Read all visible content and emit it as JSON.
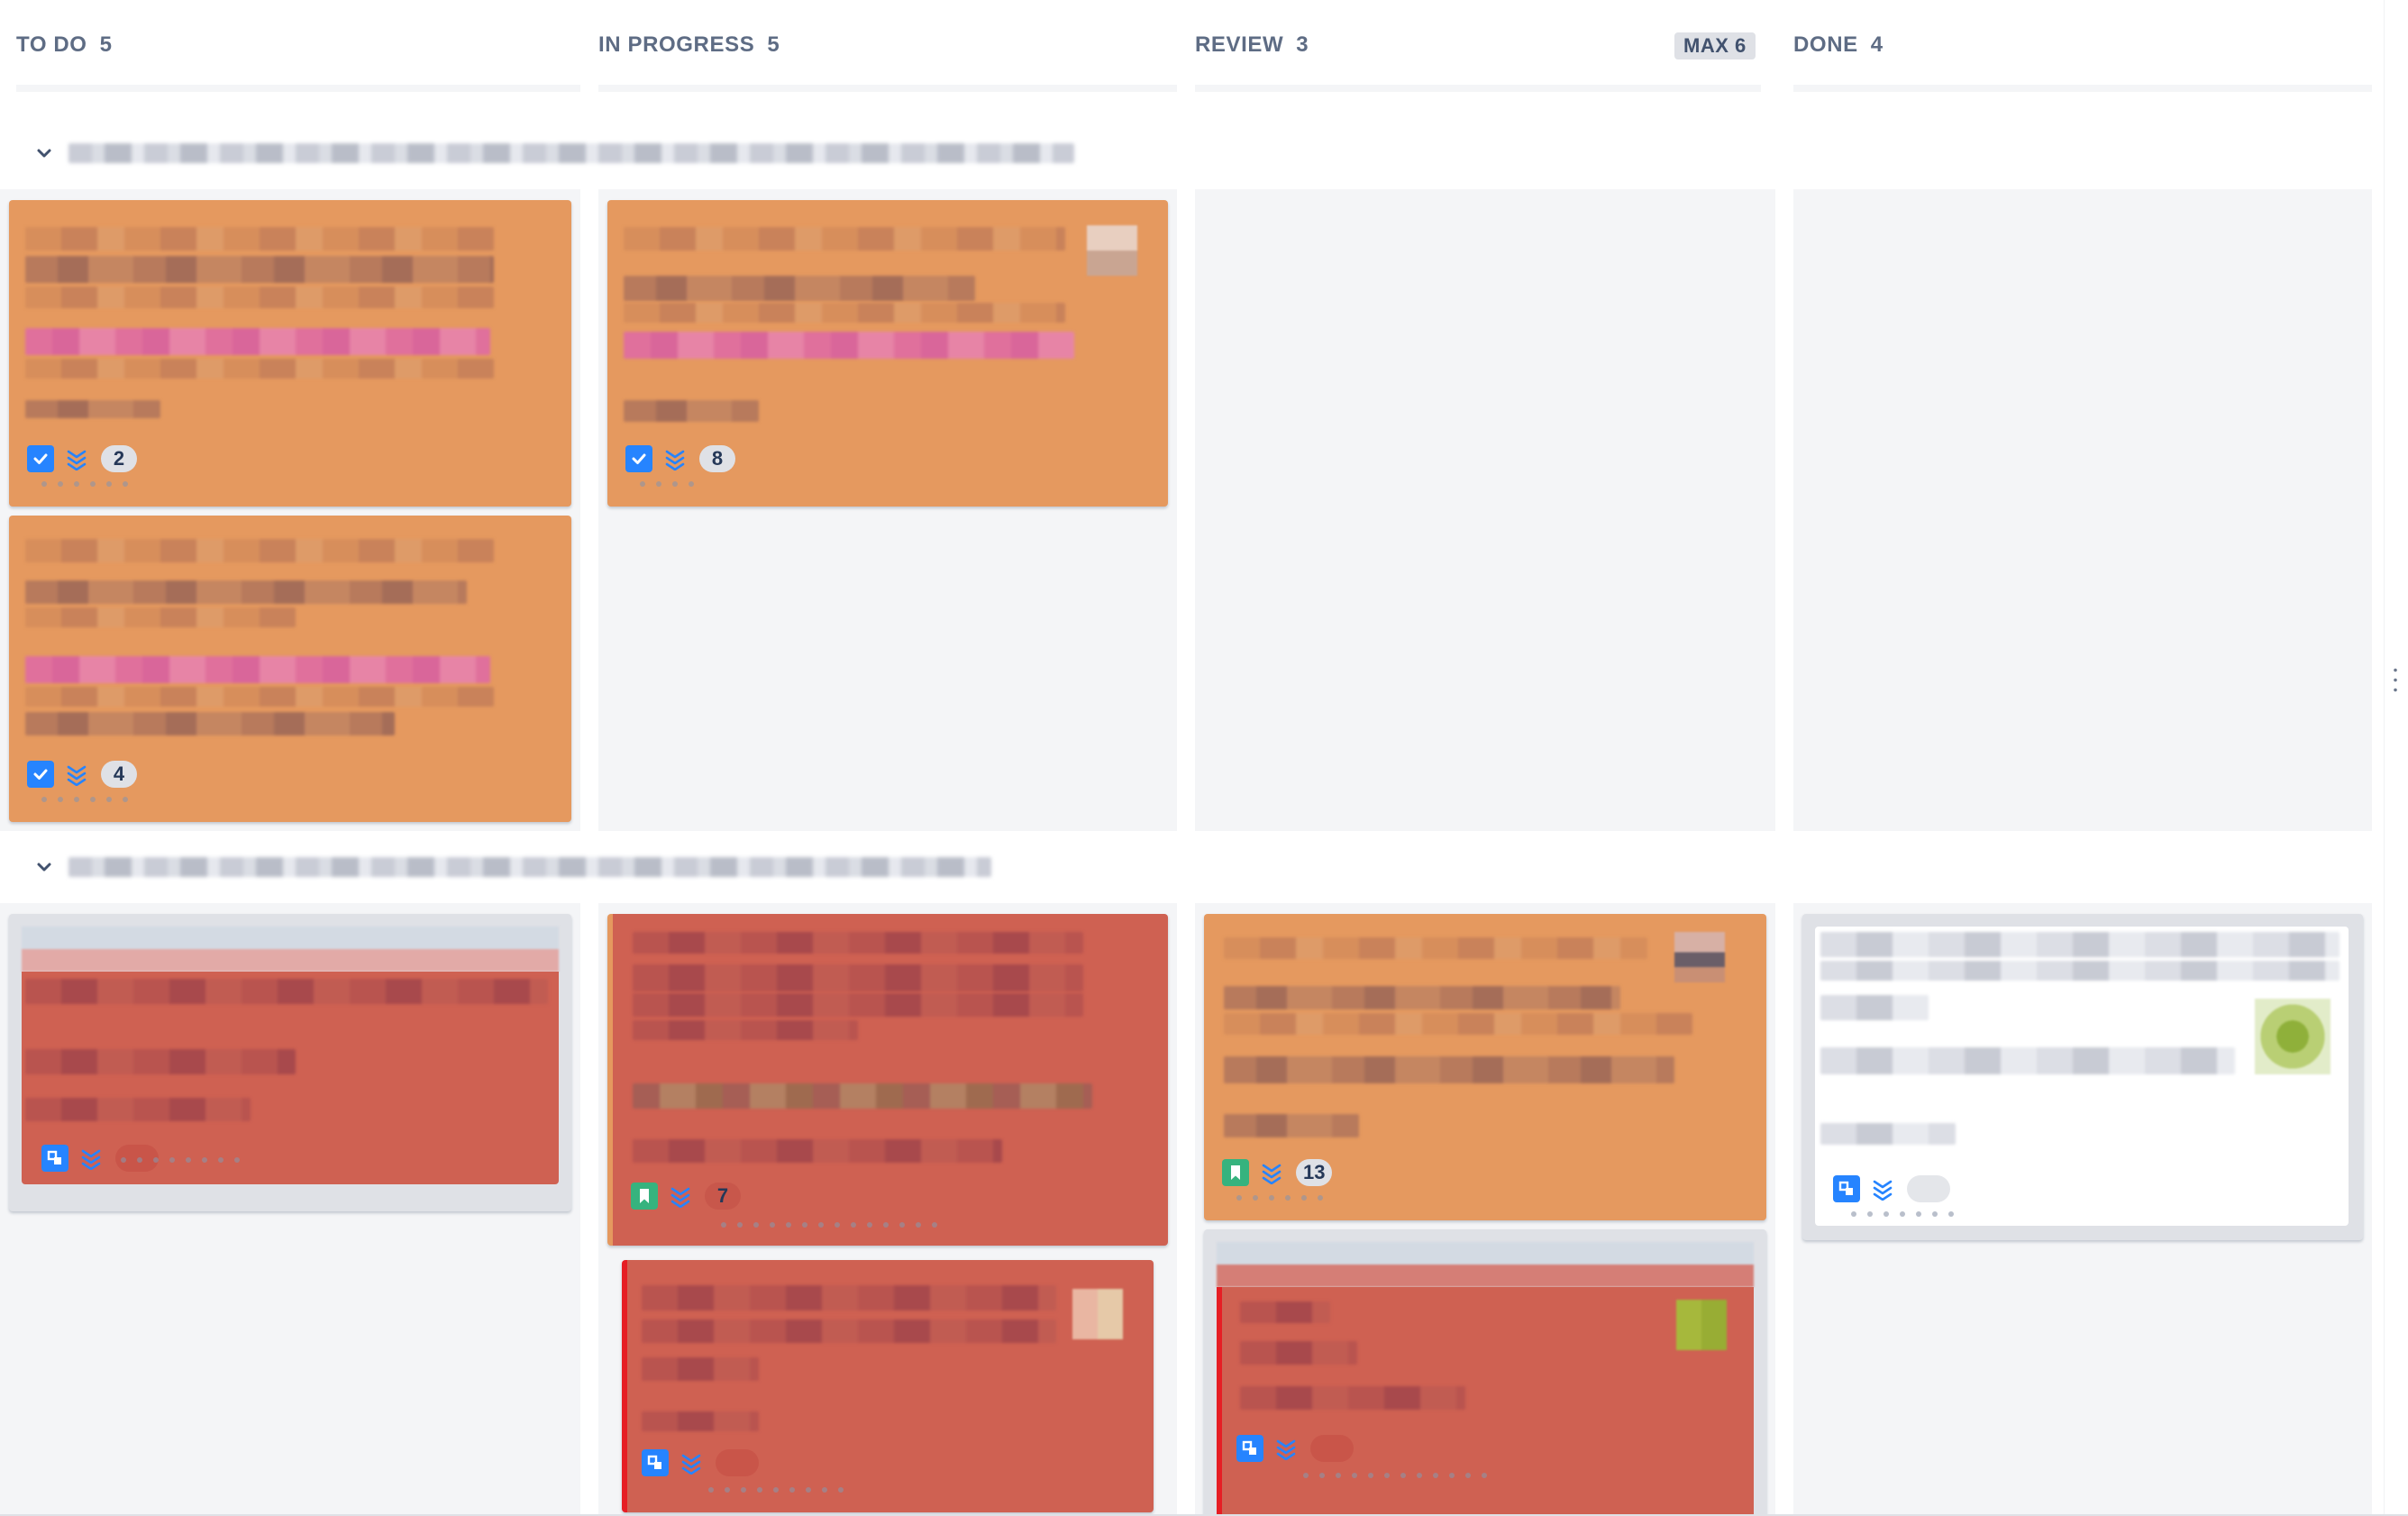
{
  "columns": [
    {
      "title": "TO DO",
      "count": "5"
    },
    {
      "title": "IN PROGRESS",
      "count": "5"
    },
    {
      "title": "REVIEW",
      "count": "3",
      "badge": "MAX 6"
    },
    {
      "title": "DONE",
      "count": "4"
    }
  ],
  "cards": {
    "todo_1_points": "2",
    "todo_2_points": "4",
    "inprog_1_points": "8",
    "inprog_2_points": "7",
    "review_1_points": "13"
  },
  "colors": {
    "card_orange": "#e5995f",
    "card_red": "#cf6152",
    "issue_blue": "#2684ff",
    "story_green": "#36b37e"
  },
  "icons": {
    "task": "checkbox-task-icon",
    "story": "bookmark-story-icon",
    "subtask": "subtask-icon",
    "priority": "lowest-priority-chevrons-icon",
    "collapse": "chevron-down-icon"
  }
}
